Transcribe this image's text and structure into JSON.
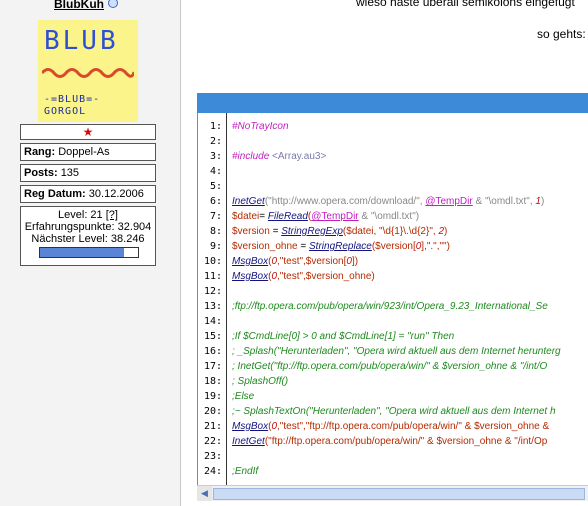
{
  "sidebar": {
    "username": "BlubKuh",
    "avatar": {
      "title": "BLUB",
      "subtitle_line1": "-=BLUB=-",
      "subtitle_line2": "GORGOL"
    },
    "rank_label": "Rang:",
    "rank_value": "Doppel-As",
    "posts_label": "Posts:",
    "posts_value": "135",
    "regdate_label": "Reg Datum:",
    "regdate_value": "30.12.2006",
    "level_text": "Level: 21",
    "level_help": "[?]",
    "xp_text": "Erfahrungspunkte: 32.904",
    "next_level_text": "Nächster Level: 38.246",
    "xp_progress_fraction": 0.86
  },
  "post": {
    "top_text": "wieso haste überall semikolons eingefügt",
    "so_gehts": "so gehts:"
  },
  "code": {
    "line_numbers": [
      "1:",
      "2:",
      "3:",
      "4:",
      "5:",
      "6:",
      "7:",
      "8:",
      "9:",
      "10:",
      "11:",
      "12:",
      "13:",
      "14:",
      "15:",
      "16:",
      "17:",
      "18:",
      "19:",
      "20:",
      "21:",
      "22:",
      "23:",
      "24:"
    ],
    "l1": "#NoTrayIcon",
    "l3a": "#include",
    "l3b": " <Array.au3>",
    "l6a": "InetGet",
    "l6b": "(\"http://www.opera.com/download/\", ",
    "l6c": "@TempDir",
    "l6d": " & \"\\omdl.txt\", ",
    "l6e": "1",
    "l6f": ")",
    "l7a": "$datei",
    "l7b": "= ",
    "l7c": "FileRead",
    "l7d": "(",
    "l7e": "@TempDir",
    "l7f": " & \"\\omdl.txt\")",
    "l8a": "$version",
    "l8b": " = ",
    "l8c": "StringRegExp",
    "l8d": "($datei, \"\\d{1}\\.\\d{2}\", ",
    "l8e": "2",
    "l8f": ")",
    "l9a": "$version_ohne",
    "l9b": " = ",
    "l9c": "StringReplace",
    "l9d": "($version[",
    "l9e": "0",
    "l9f": "],\".\",\"\")",
    "l10a": "MsgBox",
    "l10b": "(",
    "l10c": "0",
    "l10d": ",\"test\",$version[",
    "l10e": "0",
    "l10f": "])",
    "l11a": "MsgBox",
    "l11b": "(",
    "l11c": "0",
    "l11d": ",\"test\",$version_ohne)",
    "l13": ";ftp://ftp.opera.com/pub/opera/win/923/int/Opera_9.23_International_Se",
    "l15": ";If $CmdLine[0] > 0 and $CmdLine[1] = \"run\" Then",
    "l16": "; _Splash(\"Herunterladen\", \"Opera wird aktuell aus dem Internet herunterg",
    "l17": "; InetGet(\"ftp://ftp.opera.com/pub/opera/win/\" & $version_ohne & \"/int/O",
    "l18": "; SplashOff()",
    "l19": ";Else",
    "l20": ";~ SplashTextOn(\"Herunterladen\", \"Opera wird aktuell aus dem Internet h",
    "l21a": "MsgBox",
    "l21b": "(",
    "l21c": "0",
    "l21d": ",\"test\",\"ftp://ftp.opera.com/pub/opera/win/\" & $version_ohne &",
    "l22a": "InetGet",
    "l22b": "(\"ftp://ftp.opera.com/pub/opera/win/\" & $version_ohne & \"/int/Op",
    "l24": ";EndIf"
  }
}
